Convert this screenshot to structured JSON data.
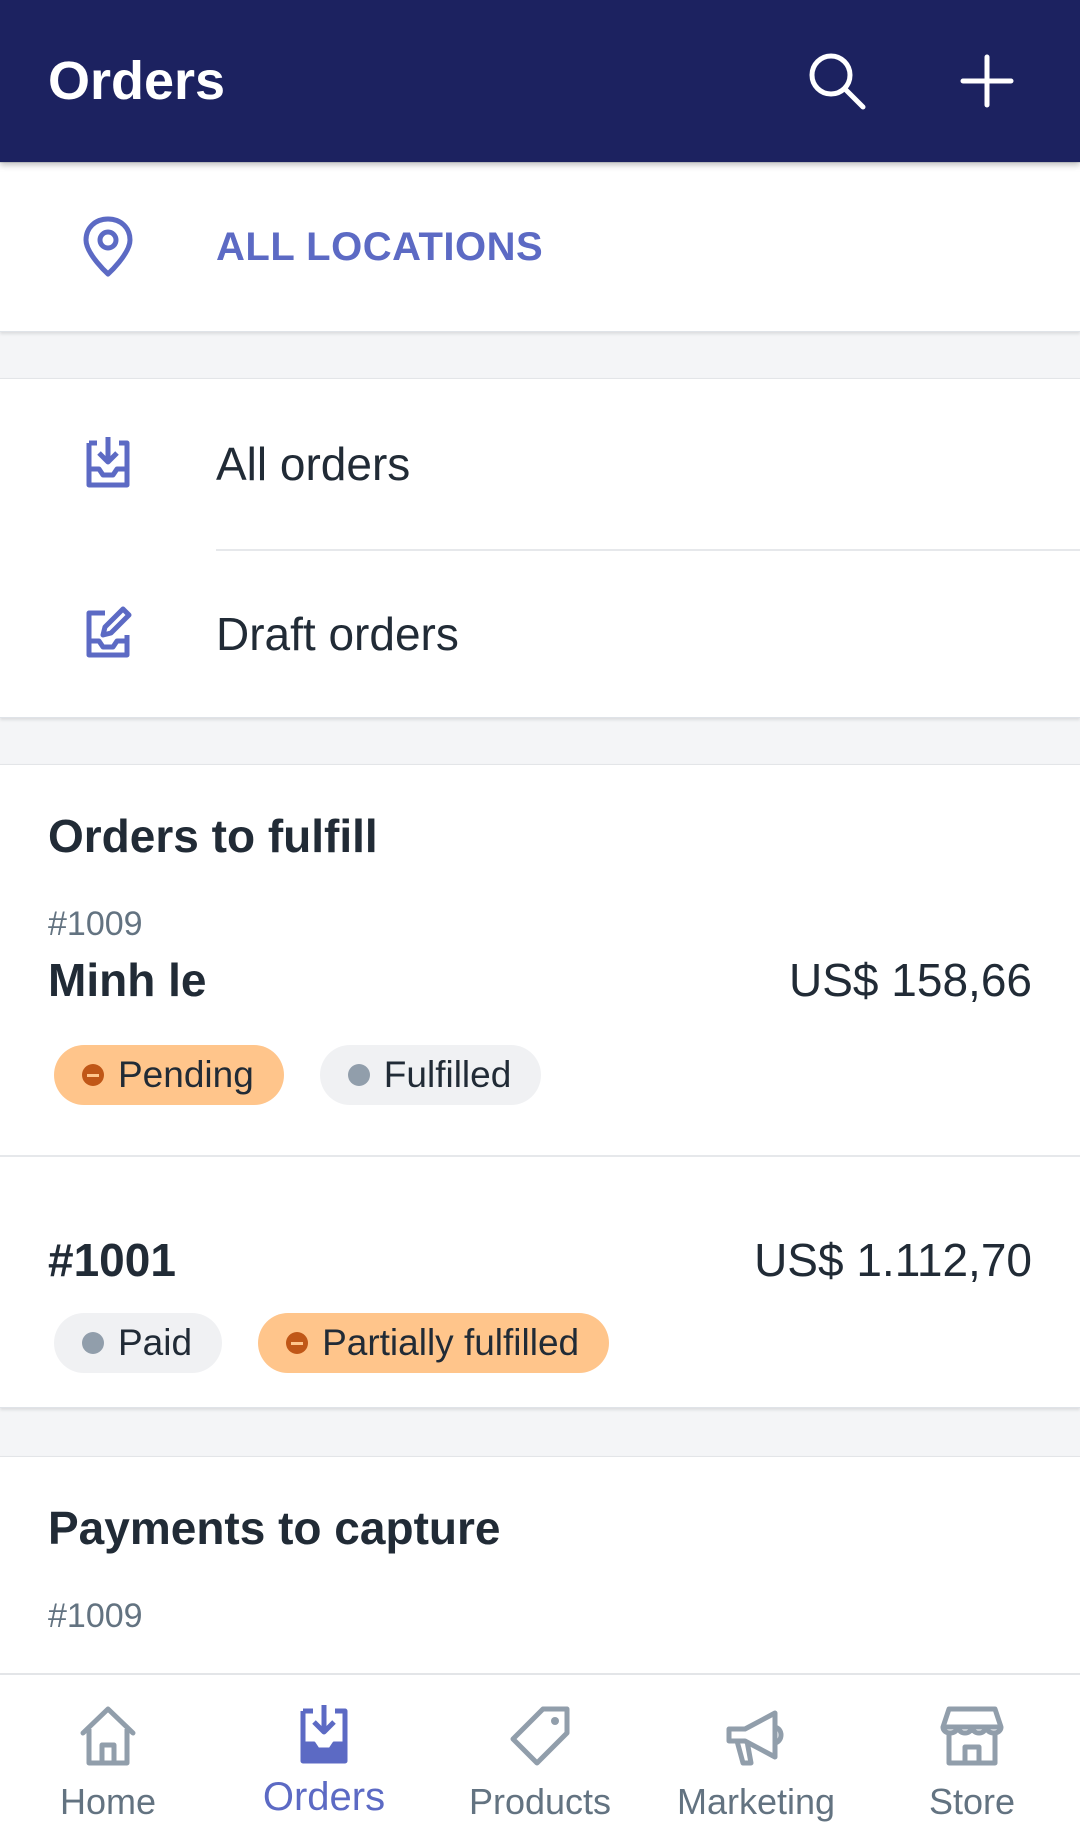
{
  "appbar": {
    "title": "Orders",
    "search_icon": "search-icon",
    "add_icon": "plus-icon",
    "background": "#1c2260"
  },
  "location": {
    "label": "ALL LOCATIONS",
    "icon": "location-pin-icon",
    "accent": "#5c6ac4"
  },
  "nav": {
    "items": [
      {
        "label": "All orders",
        "icon": "inbox-download-icon"
      },
      {
        "label": "Draft orders",
        "icon": "inbox-edit-icon"
      }
    ]
  },
  "fulfill": {
    "title": "Orders to fulfill",
    "orders": [
      {
        "number": "#1009",
        "customer": "Minh le",
        "price": "US$ 158,66",
        "badges": [
          {
            "label": "Pending",
            "status": "warning"
          },
          {
            "label": "Fulfilled",
            "status": "neutral"
          }
        ]
      },
      {
        "number": "#1001",
        "price": "US$ 1.112,70",
        "badges": [
          {
            "label": "Paid",
            "status": "neutral"
          },
          {
            "label": "Partially fulfilled",
            "status": "warning"
          }
        ]
      }
    ]
  },
  "capture": {
    "title": "Payments to capture",
    "orders": [
      {
        "number": "#1009"
      }
    ]
  },
  "bottom_nav": {
    "active": "Orders",
    "tabs": [
      {
        "label": "Home",
        "icon": "home-icon"
      },
      {
        "label": "Orders",
        "icon": "orders-icon"
      },
      {
        "label": "Products",
        "icon": "tag-icon"
      },
      {
        "label": "Marketing",
        "icon": "megaphone-icon"
      },
      {
        "label": "Store",
        "icon": "store-icon"
      }
    ]
  },
  "colors": {
    "warning_bg": "#ffc58b",
    "warning_dot": "#c05717",
    "neutral_bg": "#f0f1f3",
    "neutral_dot": "#919eab",
    "icon_inactive": "#919eab"
  }
}
